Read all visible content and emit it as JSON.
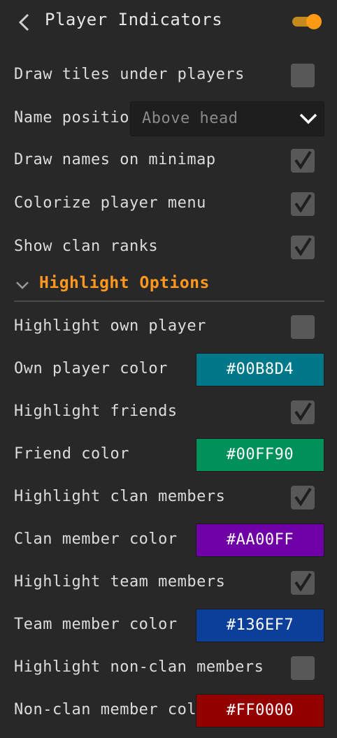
{
  "header": {
    "title": "Player Indicators",
    "enabled": true
  },
  "rows": [
    {
      "label": "Draw tiles under players",
      "type": "checkbox",
      "checked": false
    },
    {
      "label": "Name position",
      "type": "select",
      "value": "Above head"
    },
    {
      "label": "Draw names on minimap",
      "type": "checkbox",
      "checked": true
    },
    {
      "label": "Colorize player menu",
      "type": "checkbox",
      "checked": true
    },
    {
      "label": "Show clan ranks",
      "type": "checkbox",
      "checked": true
    }
  ],
  "section": {
    "title": "Highlight Options",
    "expanded": true
  },
  "highlight_rows": [
    {
      "label": "Highlight own player",
      "type": "checkbox",
      "checked": false
    },
    {
      "label": "Own player color",
      "type": "color",
      "value": "#00B8D4",
      "color": "#00788A"
    },
    {
      "label": "Highlight friends",
      "type": "checkbox",
      "checked": true
    },
    {
      "label": "Friend color",
      "type": "color",
      "value": "#00FF90",
      "color": "#00915A"
    },
    {
      "label": "Highlight clan members",
      "type": "checkbox",
      "checked": true
    },
    {
      "label": "Clan member color",
      "type": "color",
      "value": "#AA00FF",
      "color": "#6E00A6"
    },
    {
      "label": "Highlight team members",
      "type": "checkbox",
      "checked": true
    },
    {
      "label": "Team member color",
      "type": "color",
      "value": "#136EF7",
      "color": "#0C3F99"
    },
    {
      "label": "Highlight non-clan members",
      "type": "checkbox",
      "checked": false
    },
    {
      "label": "Non-clan member color",
      "type": "color",
      "value": "#FF0000",
      "color": "#930000"
    }
  ],
  "icons": {
    "back": "chevron-left-icon",
    "dropdown": "chevron-down-icon",
    "section": "chevron-down-icon",
    "check": "checkmark-icon"
  }
}
